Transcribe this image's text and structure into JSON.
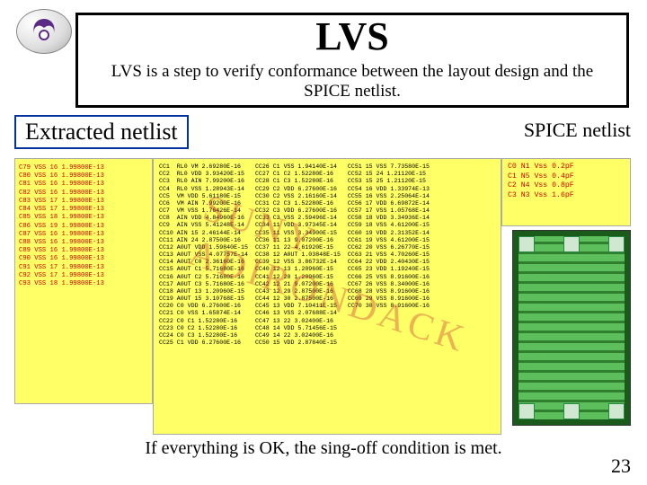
{
  "title": "LVS",
  "subtitle": "LVS is a step to verify conformance between the layout design and the SPICE netlist.",
  "section_extracted": "Extracted netlist",
  "section_spice": "SPICE netlist",
  "extracted_rows": "C79 VSS 16 1.99800E-13\nC80 VSS 16 1.99800E-13\nC81 VSS 16 1.99800E-13\nC82 VSS 16 1.99800E-13\nC83 VSS 17 1.99800E-13\nC84 VSS 17 1.99800E-13\nC85 VSS 18 1.99800E-13\nC86 VSS 19 1.99800E-13\nC87 VSS 16 1.99800E-13\nC88 VSS 16 1.99800E-13\nC89 VSS 16 1.99800E-13\nC90 VSS 16 1.99800E-13\nC91 VSS 17 1.99800E-13\nC92 VSS 17 1.99800E-13\nC93 VSS 18 1.99800E-13",
  "mid_col1": "CC1  RL0 VM 2.69280E-16\nCC2  RL0 VDD 3.93420E-15\nCC3  RL0 AIN 7.99200E-16\nCC4  RL0 VSS 1.28943E-14\nCC5  VM VDD 5.61180E-15\nCC6  VM AIN 7.99200E-16\nCC7  VM VSS 1.76426E-14\nCC8  AIN VDD 4.84960E-16\nCC9  AIN VSS 5.41248E-14\nCC10 AIN 15 2.46144E-14\nCC11 AIN 24 2.87500E-16\nCC12 A0UT VDD 1.59840E-15\nCC13 A0UT VSS 4.07757E-14\nCC14 A0UT C0 2.36160E-16\nCC15 A0UT C1 5.71680E-16\nCC16 A0UT C2 5.71680E-16\nCC17 A0UT C3 5.71680E-16\nCC18 A0UT 13 1.20960E-15\nCC19 A0UT 15 3.10768E-15\nCC20 C0 VDD 6.27600E-16\nCC21 C0 VSS 1.65874E-14\nCC22 C0 C1 1.52280E-16\nCC23 C0 C2 1.52280E-16\nCC24 C0 C3 1.52280E-16\nCC25 C1 VDD 6.27600E-16",
  "mid_col2": "CC26 C1 VSS 1.94140E-14\nCC27 C1 C2 1.52280E-16\nCC28 C1 C3 1.52280E-16\nCC29 C2 VDD 6.27600E-16\nCC30 C2 VSS 2.16160E-14\nCC31 C2 C3 1.52280E-16\nCC32 C3 VDD 6.27600E-16\nCC33 C3 VSS 2.59496E-14\nCC34 11 VDD 3.97345E-14\nCC35 11 VSS 3.34900E-15\nCC36 11 13 9.07200E-16\nCC37 11 22 4.61920E-15\nCC38 12 A0UT 1.03848E-15\nCC39 12 VSS 3.86732E-14\nCC40 12 13 1.20960E-15\nCC41 12 20 1.20960E-15\nCC42 12 21 9.07200E-16\nCC43 12 29 2.87500E-16\nCC44 12 30 2.87500E-16\nCC45 13 VDD 7.10411E-15\nCC46 13 VSS 2.07688E-14\nCC47 13 22 3.02400E-16\nCC48 14 VDD 5.71456E-15\nCC49 14 22 3.02400E-16\nCC50 15 VDD 2.87840E-15",
  "mid_col3": "CC51 15 VSS 7.73580E-15\nCC52 15 24 1.21120E-15\nCC53 15 25 1.21120E-15\nCC54 16 VDD 1.33974E-13\nCC55 16 VSS 2.25064E-14\nCC56 17 VDD 6.69872E-14\nCC57 17 VSS 1.05768E-14\nCC58 18 VDD 3.34936E-14\nCC59 18 VSS 4.61200E-15\nCC60 19 VDD 2.31352E-14\nCC61 19 VSS 4.61200E-15\nCC62 20 VSS 6.26770E-15\nCC63 21 VSS 4.70260E-15\nCC64 22 VDD 2.40430E-15\nCC65 23 VDD 1.19240E-15\nCC66 25 VSS 8.91600E-16\nCC67 26 VSS 8.34000E-16\nCC68 28 VSS 8.91600E-16\nCC69 29 VSS 8.91600E-16\nCC70 30 VSS 8.91600E-16",
  "spice_rows": "C0 N1 Vss 0.2pF\nC1 N5 Vss 0.4pF\nC2 N4 Vss 0.8pF\nC3 N3 Vss 1.6pF",
  "watermark": "SUNY ADIRONDACK",
  "footer": "If everything is OK, the sing-off condition is met.",
  "page_number": "23"
}
